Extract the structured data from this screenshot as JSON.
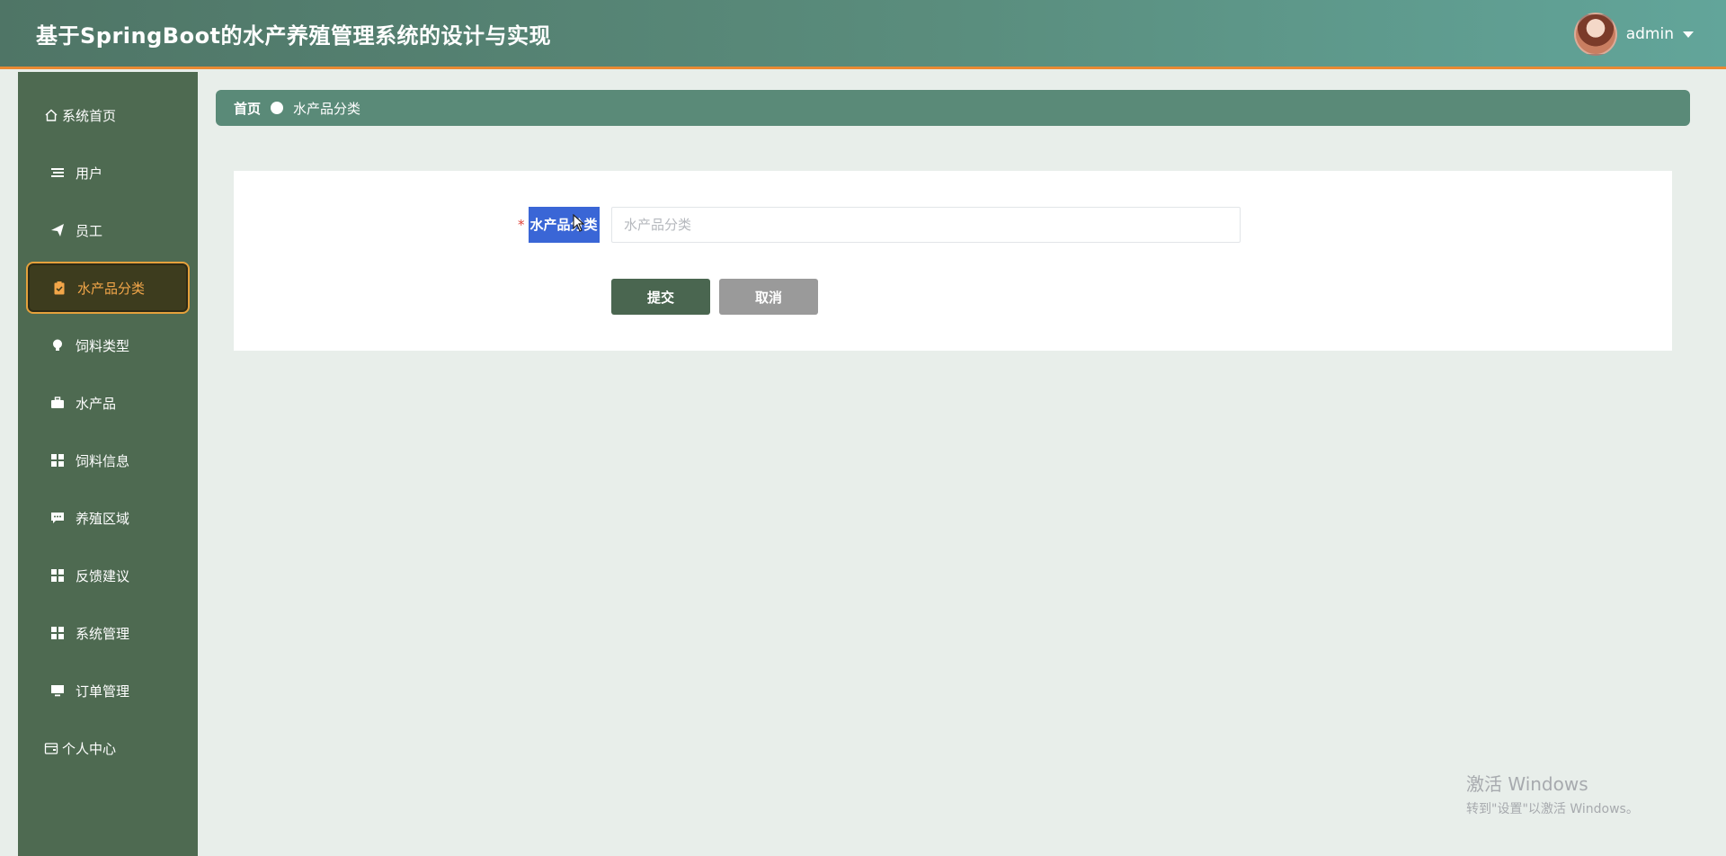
{
  "header": {
    "title": "基于SpringBoot的水产养殖管理系统的设计与实现",
    "username": "admin"
  },
  "sidebar": {
    "items": [
      {
        "label": "系统首页",
        "icon": "home-icon"
      },
      {
        "label": "用户",
        "icon": "list-icon"
      },
      {
        "label": "员工",
        "icon": "send-icon"
      },
      {
        "label": "水产品分类",
        "icon": "clipboard-icon",
        "active": true
      },
      {
        "label": "饲料类型",
        "icon": "bulb-icon"
      },
      {
        "label": "水产品",
        "icon": "briefcase-icon"
      },
      {
        "label": "饲料信息",
        "icon": "grid-icon"
      },
      {
        "label": "养殖区域",
        "icon": "chat-icon"
      },
      {
        "label": "反馈建议",
        "icon": "grid-icon"
      },
      {
        "label": "系统管理",
        "icon": "grid-icon"
      },
      {
        "label": "订单管理",
        "icon": "monitor-icon"
      },
      {
        "label": "个人中心",
        "icon": "wallet-icon"
      }
    ]
  },
  "breadcrumb": {
    "home": "首页",
    "current": "水产品分类"
  },
  "form": {
    "required_mark": "*",
    "label": "水产品分类",
    "input_value": "",
    "placeholder": "水产品分类",
    "submit_label": "提交",
    "cancel_label": "取消"
  },
  "watermark": {
    "title": "激活 Windows",
    "subtitle": "转到\"设置\"以激活 Windows。"
  },
  "colors": {
    "accent": "#e98a33",
    "sidebar": "#4e6a51",
    "breadcrumb": "#5a8a78",
    "submit": "#4a6650",
    "active_text": "#f2a649"
  }
}
